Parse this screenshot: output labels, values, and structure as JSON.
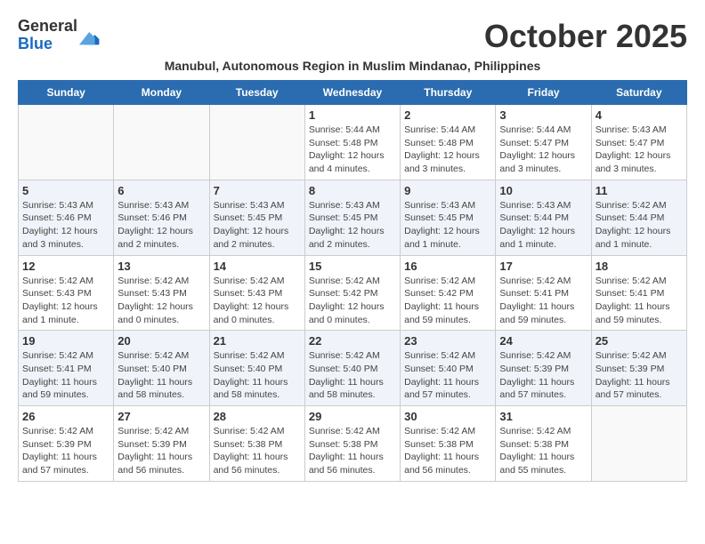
{
  "logo": {
    "general": "General",
    "blue": "Blue"
  },
  "title": "October 2025",
  "subtitle": "Manubul, Autonomous Region in Muslim Mindanao, Philippines",
  "days_of_week": [
    "Sunday",
    "Monday",
    "Tuesday",
    "Wednesday",
    "Thursday",
    "Friday",
    "Saturday"
  ],
  "weeks": [
    [
      {
        "day": "",
        "info": ""
      },
      {
        "day": "",
        "info": ""
      },
      {
        "day": "",
        "info": ""
      },
      {
        "day": "1",
        "info": "Sunrise: 5:44 AM\nSunset: 5:48 PM\nDaylight: 12 hours\nand 4 minutes."
      },
      {
        "day": "2",
        "info": "Sunrise: 5:44 AM\nSunset: 5:48 PM\nDaylight: 12 hours\nand 3 minutes."
      },
      {
        "day": "3",
        "info": "Sunrise: 5:44 AM\nSunset: 5:47 PM\nDaylight: 12 hours\nand 3 minutes."
      },
      {
        "day": "4",
        "info": "Sunrise: 5:43 AM\nSunset: 5:47 PM\nDaylight: 12 hours\nand 3 minutes."
      }
    ],
    [
      {
        "day": "5",
        "info": "Sunrise: 5:43 AM\nSunset: 5:46 PM\nDaylight: 12 hours\nand 3 minutes."
      },
      {
        "day": "6",
        "info": "Sunrise: 5:43 AM\nSunset: 5:46 PM\nDaylight: 12 hours\nand 2 minutes."
      },
      {
        "day": "7",
        "info": "Sunrise: 5:43 AM\nSunset: 5:45 PM\nDaylight: 12 hours\nand 2 minutes."
      },
      {
        "day": "8",
        "info": "Sunrise: 5:43 AM\nSunset: 5:45 PM\nDaylight: 12 hours\nand 2 minutes."
      },
      {
        "day": "9",
        "info": "Sunrise: 5:43 AM\nSunset: 5:45 PM\nDaylight: 12 hours\nand 1 minute."
      },
      {
        "day": "10",
        "info": "Sunrise: 5:43 AM\nSunset: 5:44 PM\nDaylight: 12 hours\nand 1 minute."
      },
      {
        "day": "11",
        "info": "Sunrise: 5:42 AM\nSunset: 5:44 PM\nDaylight: 12 hours\nand 1 minute."
      }
    ],
    [
      {
        "day": "12",
        "info": "Sunrise: 5:42 AM\nSunset: 5:43 PM\nDaylight: 12 hours\nand 1 minute."
      },
      {
        "day": "13",
        "info": "Sunrise: 5:42 AM\nSunset: 5:43 PM\nDaylight: 12 hours\nand 0 minutes."
      },
      {
        "day": "14",
        "info": "Sunrise: 5:42 AM\nSunset: 5:43 PM\nDaylight: 12 hours\nand 0 minutes."
      },
      {
        "day": "15",
        "info": "Sunrise: 5:42 AM\nSunset: 5:42 PM\nDaylight: 12 hours\nand 0 minutes."
      },
      {
        "day": "16",
        "info": "Sunrise: 5:42 AM\nSunset: 5:42 PM\nDaylight: 11 hours\nand 59 minutes."
      },
      {
        "day": "17",
        "info": "Sunrise: 5:42 AM\nSunset: 5:41 PM\nDaylight: 11 hours\nand 59 minutes."
      },
      {
        "day": "18",
        "info": "Sunrise: 5:42 AM\nSunset: 5:41 PM\nDaylight: 11 hours\nand 59 minutes."
      }
    ],
    [
      {
        "day": "19",
        "info": "Sunrise: 5:42 AM\nSunset: 5:41 PM\nDaylight: 11 hours\nand 59 minutes."
      },
      {
        "day": "20",
        "info": "Sunrise: 5:42 AM\nSunset: 5:40 PM\nDaylight: 11 hours\nand 58 minutes."
      },
      {
        "day": "21",
        "info": "Sunrise: 5:42 AM\nSunset: 5:40 PM\nDaylight: 11 hours\nand 58 minutes."
      },
      {
        "day": "22",
        "info": "Sunrise: 5:42 AM\nSunset: 5:40 PM\nDaylight: 11 hours\nand 58 minutes."
      },
      {
        "day": "23",
        "info": "Sunrise: 5:42 AM\nSunset: 5:40 PM\nDaylight: 11 hours\nand 57 minutes."
      },
      {
        "day": "24",
        "info": "Sunrise: 5:42 AM\nSunset: 5:39 PM\nDaylight: 11 hours\nand 57 minutes."
      },
      {
        "day": "25",
        "info": "Sunrise: 5:42 AM\nSunset: 5:39 PM\nDaylight: 11 hours\nand 57 minutes."
      }
    ],
    [
      {
        "day": "26",
        "info": "Sunrise: 5:42 AM\nSunset: 5:39 PM\nDaylight: 11 hours\nand 57 minutes."
      },
      {
        "day": "27",
        "info": "Sunrise: 5:42 AM\nSunset: 5:39 PM\nDaylight: 11 hours\nand 56 minutes."
      },
      {
        "day": "28",
        "info": "Sunrise: 5:42 AM\nSunset: 5:38 PM\nDaylight: 11 hours\nand 56 minutes."
      },
      {
        "day": "29",
        "info": "Sunrise: 5:42 AM\nSunset: 5:38 PM\nDaylight: 11 hours\nand 56 minutes."
      },
      {
        "day": "30",
        "info": "Sunrise: 5:42 AM\nSunset: 5:38 PM\nDaylight: 11 hours\nand 56 minutes."
      },
      {
        "day": "31",
        "info": "Sunrise: 5:42 AM\nSunset: 5:38 PM\nDaylight: 11 hours\nand 55 minutes."
      },
      {
        "day": "",
        "info": ""
      }
    ]
  ]
}
